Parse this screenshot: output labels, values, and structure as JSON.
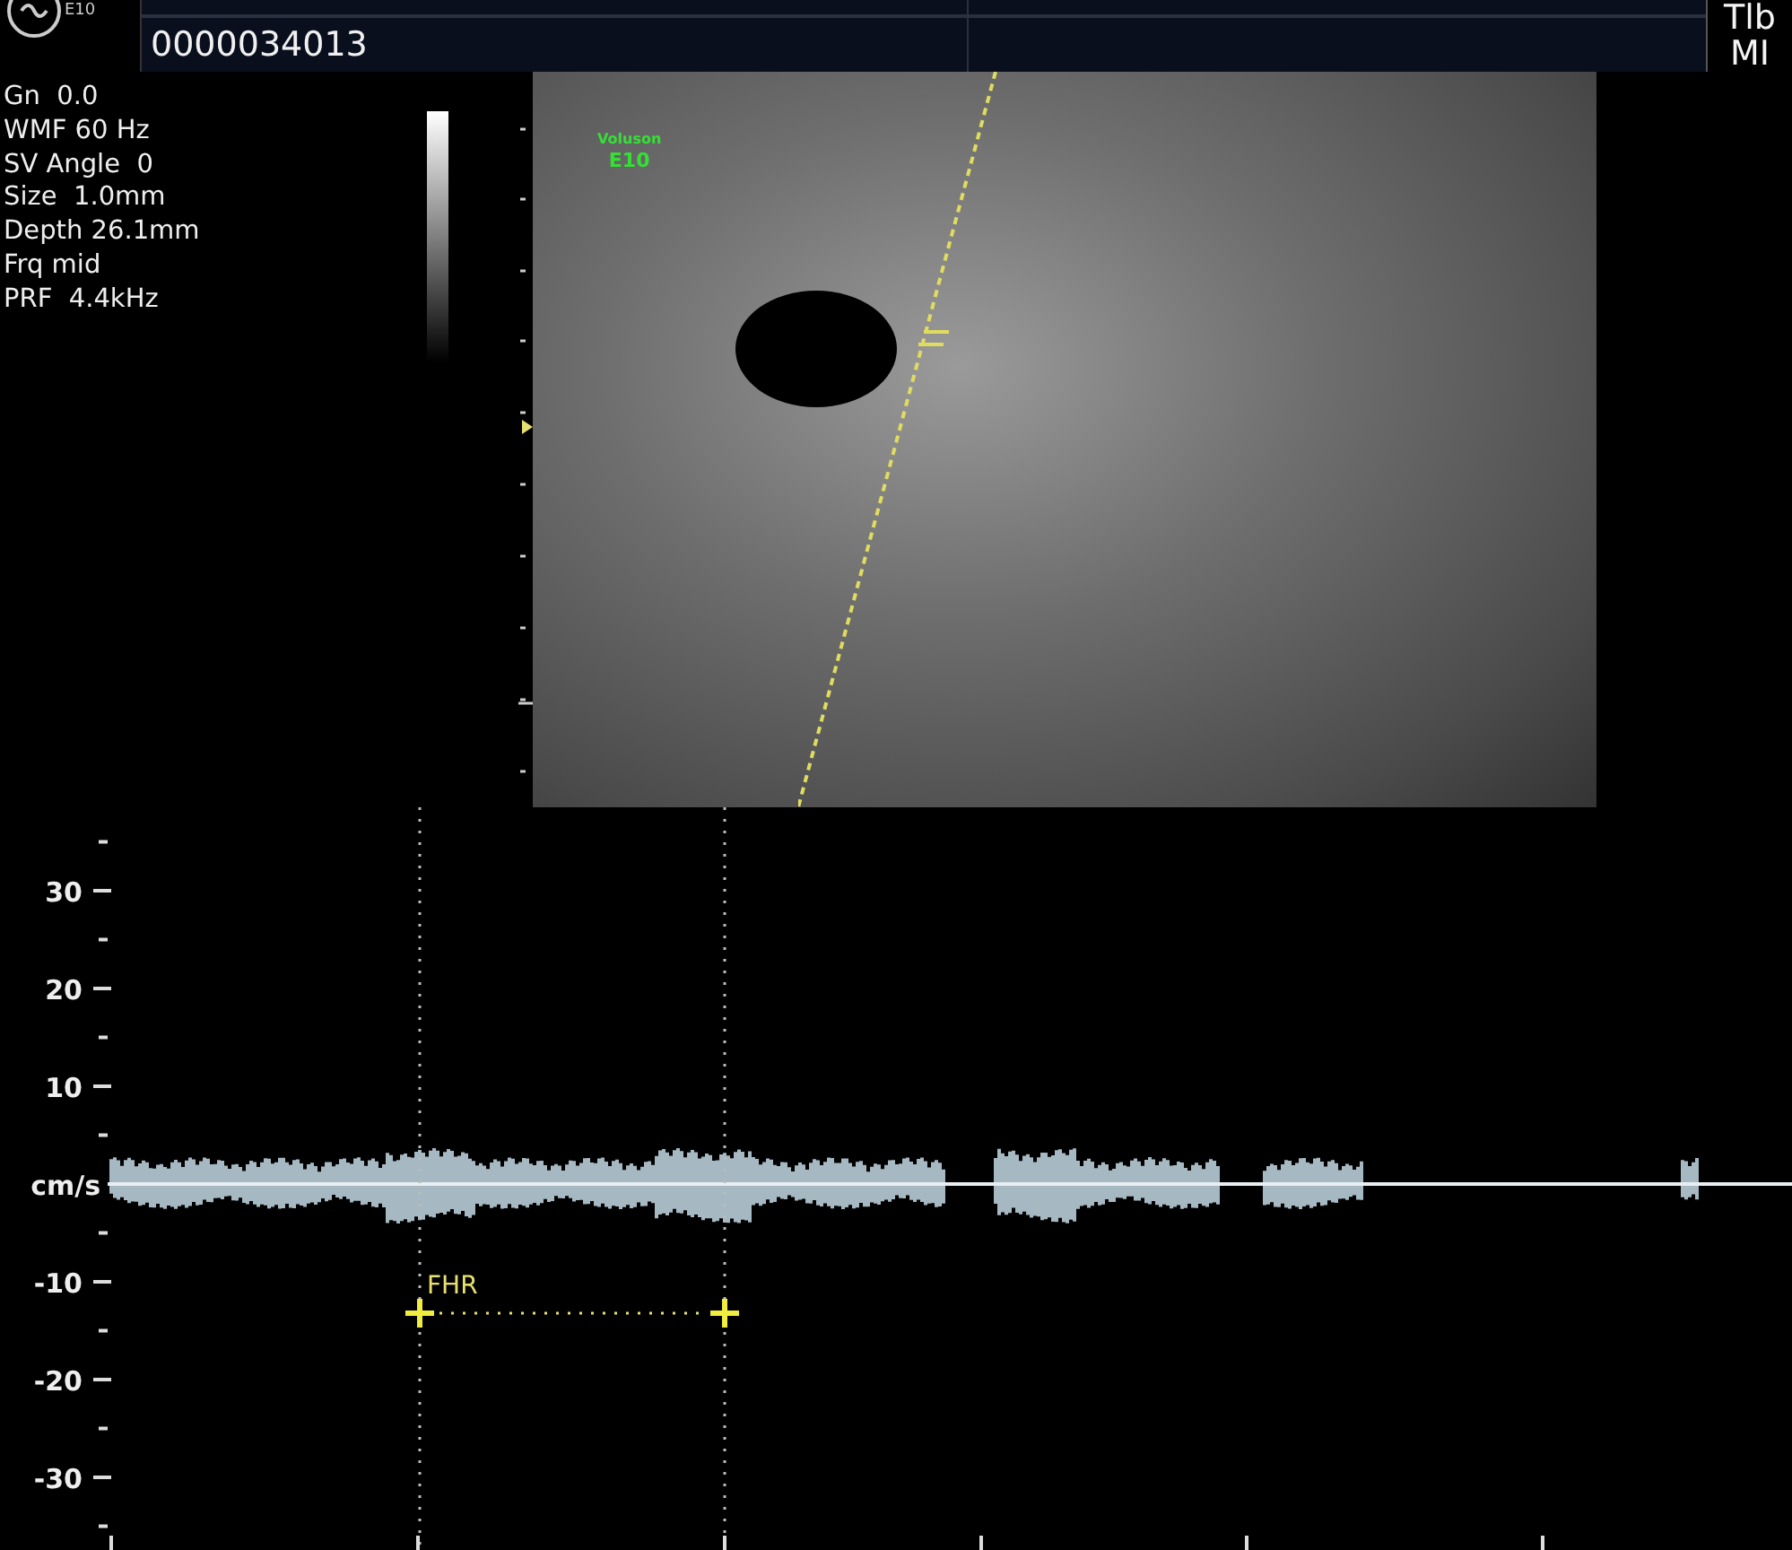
{
  "header": {
    "model": "E10",
    "patient_id": "0000034013",
    "indicators": [
      "Tlb",
      "MI"
    ]
  },
  "parameters": [
    "Gn  0.0",
    "WMF 60 Hz",
    "SV Angle  0",
    "Size  1.0mm",
    "Depth 26.1mm",
    "Frq mid",
    "PRF  4.4kHz"
  ],
  "image": {
    "brand": "Voluson",
    "model": "E10"
  },
  "doppler": {
    "axis_labels": [
      "30",
      "20",
      "10",
      "cm/s",
      "-10",
      "-20",
      "-30"
    ],
    "caliper_label": "FHR"
  }
}
